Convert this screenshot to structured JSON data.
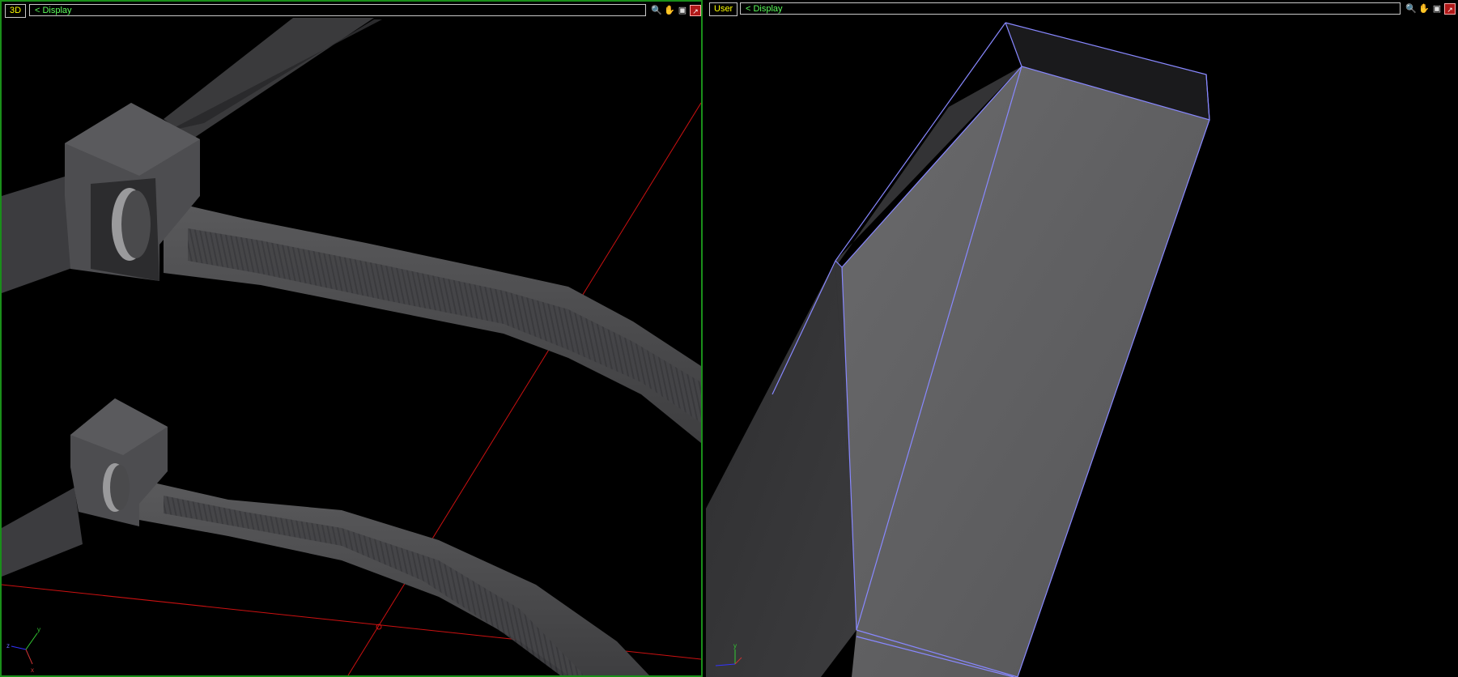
{
  "viewports": {
    "left": {
      "label": "3D",
      "nav": "< Display"
    },
    "right": {
      "label": "User",
      "nav": "< Display"
    }
  },
  "toolbar_icons": [
    "zoom-icon",
    "pan-hand-icon",
    "camera-icon",
    "maximize-icon"
  ],
  "axes": {
    "x": "x",
    "y": "y",
    "z": "z"
  },
  "colors": {
    "active_border": "#1a8f1a",
    "label_text": "#5cff5c",
    "grid_line": "#cc1111",
    "wire_edges": "#8888ff"
  }
}
